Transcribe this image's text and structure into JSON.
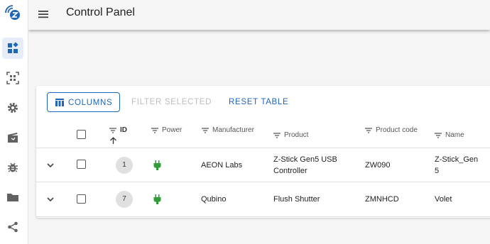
{
  "app": {
    "title": "Control Panel"
  },
  "colors": {
    "accent": "#1e66b8",
    "power_on": "#2e9d3a",
    "disabled": "#bdbdbd"
  },
  "sidebar": {
    "items": [
      {
        "icon": "dashboard-icon",
        "active": true
      },
      {
        "icon": "qr-code-scan-icon",
        "active": false
      },
      {
        "icon": "settings-gear-icon",
        "active": false
      },
      {
        "icon": "scenes-clapperboard-icon",
        "active": false
      },
      {
        "icon": "debug-bug-icon",
        "active": false
      },
      {
        "icon": "folder-icon",
        "active": false
      },
      {
        "icon": "share-icon",
        "active": false
      }
    ]
  },
  "toolbar": {
    "columns_label": "Columns",
    "filter_label": "Filter selected",
    "reset_label": "Reset table"
  },
  "table": {
    "headers": {
      "id": "ID",
      "power": "Power",
      "manufacturer": "Manufacturer",
      "product": "Product",
      "product_code": "Product code",
      "name": "Name"
    },
    "sort": {
      "column": "ID",
      "direction": "ascending"
    },
    "rows": [
      {
        "id": "1",
        "power": "plugged-in",
        "manufacturer": "AEON Labs",
        "product": "Z-Stick Gen5 USB Controller",
        "product_code": "ZW090",
        "name": "Z-Stick_Gen5"
      },
      {
        "id": "7",
        "power": "plugged-in",
        "manufacturer": "Qubino",
        "product": "Flush Shutter",
        "product_code": "ZMNHCD",
        "name": "Volet"
      }
    ]
  }
}
